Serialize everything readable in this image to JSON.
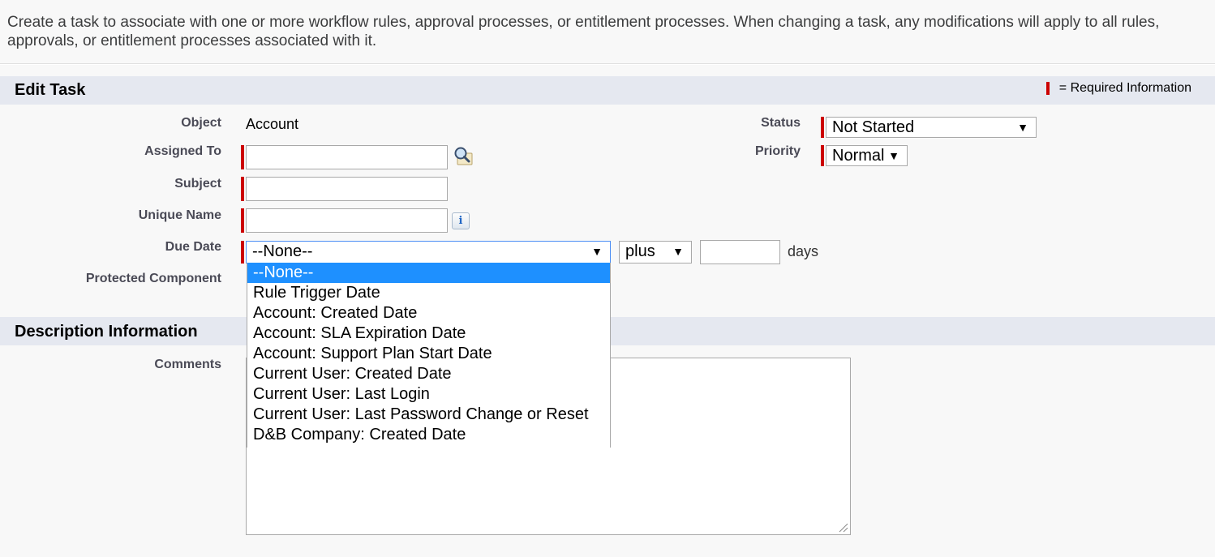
{
  "intro": "Create a task to associate with one or more workflow rules, approval processes, or entitlement processes. When changing a task, any modifications will apply to all rules, approvals, or entitlement processes associated with it.",
  "edit_section": {
    "title": "Edit Task",
    "required_legend": "= Required Information"
  },
  "fields": {
    "object": {
      "label": "Object",
      "value": "Account"
    },
    "assigned_to": {
      "label": "Assigned To",
      "value": ""
    },
    "subject": {
      "label": "Subject",
      "value": ""
    },
    "unique_name": {
      "label": "Unique Name",
      "value": ""
    },
    "due_date": {
      "label": "Due Date",
      "selected": "--None--",
      "operator": "plus",
      "days_value": "",
      "days_label": "days",
      "options": [
        "--None--",
        "Rule Trigger Date",
        "Account: Created Date",
        "Account: SLA Expiration Date",
        "Account: Support Plan Start Date",
        "Current User: Created Date",
        "Current User: Last Login",
        "Current User: Last Password Change or Reset",
        "D&B Company: Created Date"
      ]
    },
    "protected_component": {
      "label": "Protected Component"
    },
    "status": {
      "label": "Status",
      "value": "Not Started"
    },
    "priority": {
      "label": "Priority",
      "value": "Normal"
    }
  },
  "description_section": {
    "title": "Description Information",
    "comments_label": "Comments",
    "comments_value": ""
  },
  "icons": {
    "lookup": "magnifier-lookup-icon",
    "info": "info-icon",
    "dropdown_arrow": "caret-down-icon"
  },
  "colors": {
    "required": "#c00000",
    "section_bar": "#e5e8f0",
    "selected_option": "#1e90ff"
  }
}
